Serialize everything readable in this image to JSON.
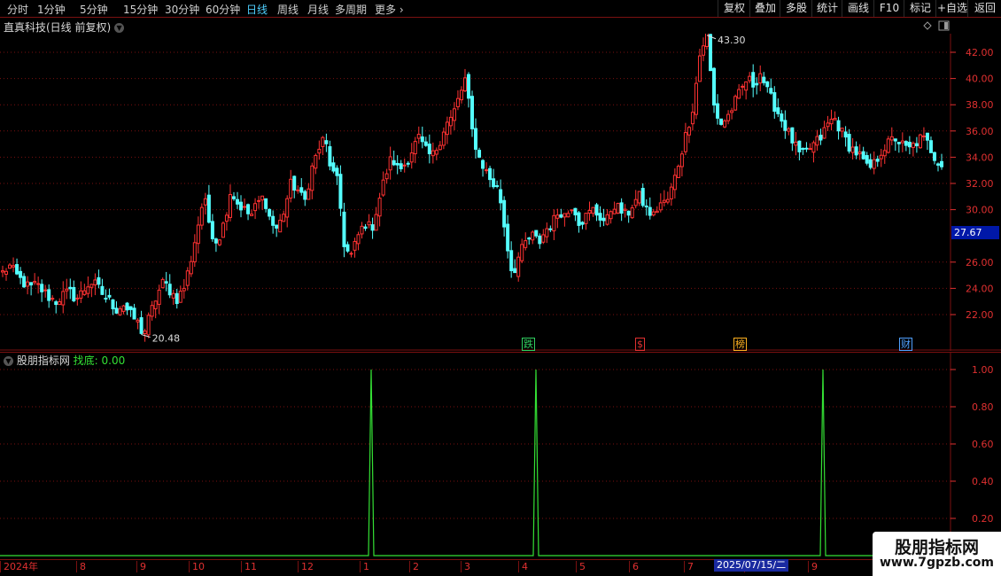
{
  "toolbar": {
    "timeframes": [
      "分时",
      "1分钟",
      "5分钟",
      "15分钟",
      "30分钟",
      "60分钟",
      "日线",
      "周线",
      "月线",
      "多周期",
      "更多"
    ],
    "active_timeframe": "日线",
    "right_buttons": [
      "复权",
      "叠加",
      "多股",
      "统计",
      "画线",
      "F10",
      "标记",
      "+自选",
      "返回"
    ]
  },
  "main_panel": {
    "title": "直真科技(日线 前复权)",
    "high_label": "43.30",
    "low_label": "20.48",
    "current_price": "27.67",
    "y_axis_labels": [
      "42.00",
      "40.00",
      "38.00",
      "36.00",
      "34.00",
      "32.00",
      "30.00",
      "26.00",
      "24.00",
      "22.00"
    ],
    "event_markers": [
      {
        "label": "跌",
        "color": "#30d060"
      },
      {
        "label": "$",
        "color": "#e03030"
      },
      {
        "label": "榜",
        "color": "#ffb020"
      },
      {
        "label": "财",
        "color": "#50a0ff"
      }
    ]
  },
  "indicator_panel": {
    "title": "股朋指标网",
    "signal_label": "找底:",
    "signal_value": "0.00",
    "y_axis_labels": [
      "1.00",
      "0.80",
      "0.60",
      "0.40",
      "0.20"
    ]
  },
  "time_axis": {
    "labels": [
      "2024年",
      "8",
      "9",
      "10",
      "11",
      "12",
      "1",
      "2",
      "3",
      "4",
      "5",
      "6",
      "7",
      "8",
      "9"
    ],
    "cursor_date": "2025/07/15/二"
  },
  "watermark": {
    "line1": "股朋指标网",
    "line2": "www.7gpzb.com"
  },
  "colors": {
    "up": "#ff3232",
    "down": "#54ffff",
    "signal": "#34e034",
    "grid": "#7a1010"
  },
  "chart_data": [
    {
      "type": "candlestick",
      "title": "直真科技(日线 前复权)",
      "ylim": [
        20.5,
        43.5
      ],
      "annotations": {
        "high": 43.3,
        "low": 20.48,
        "last": 27.67
      },
      "series": [
        {
          "values": [
            25.2,
            25.7,
            25.0,
            24.5,
            24.0,
            24.3,
            23.8,
            23.3,
            23.0,
            23.5,
            23.7,
            23.2,
            23.8,
            24.5,
            24.2,
            23.5,
            23.0,
            22.4,
            22.8,
            22.0,
            21.5,
            20.48,
            22.0,
            23.5,
            24.5,
            23.8,
            23.2,
            24.0,
            26.0,
            28.5,
            31.0,
            28.5,
            27.5,
            29.0,
            31.5,
            30.5,
            30.0,
            29.5,
            30.5,
            31.0,
            29.0,
            28.5,
            30.0,
            32.0,
            31.5,
            30.5,
            33.0,
            34.5,
            35.5,
            33.0,
            32.0,
            27.0,
            26.5,
            28.0,
            29.0,
            28.5,
            30.5,
            32.5,
            34.0,
            33.0,
            33.5,
            34.5,
            35.5,
            34.5,
            34.0,
            35.0,
            36.5,
            37.0,
            38.5,
            40.0,
            36.0,
            34.0,
            33.0,
            32.0,
            31.5,
            28.0,
            25.0,
            26.5,
            27.5,
            28.0,
            27.5,
            28.5,
            29.0,
            30.0,
            29.5,
            30.5,
            29.0,
            29.5,
            30.0,
            29.5,
            29.0,
            30.5,
            30.0,
            29.5,
            30.5,
            31.0,
            30.0,
            29.5,
            30.5,
            30.5,
            32.0,
            34.0,
            36.0,
            38.0,
            42.0,
            43.3,
            38.0,
            36.5,
            37.0,
            38.0,
            39.0,
            40.0,
            39.5,
            40.5,
            39.0,
            38.0,
            37.0,
            36.0,
            35.0,
            34.0,
            34.5,
            35.0,
            35.5,
            36.5,
            37.0,
            36.0,
            35.0,
            34.5,
            34.0,
            33.0,
            33.5,
            34.5,
            35.0,
            35.5,
            35.0,
            34.5,
            35.0,
            35.5,
            35.0,
            34.0,
            33.5
          ]
        }
      ]
    },
    {
      "type": "line",
      "title": "股朋指标网",
      "ylim": [
        0,
        1.05
      ],
      "series": [
        {
          "name": "找底",
          "spikes": [
            {
              "date": "2025年1月",
              "value": 1.0
            },
            {
              "date": "2025年4月",
              "value": 1.0
            },
            {
              "date": "2025年9月",
              "value": 1.0
            }
          ],
          "baseline": 0.0
        }
      ]
    }
  ]
}
